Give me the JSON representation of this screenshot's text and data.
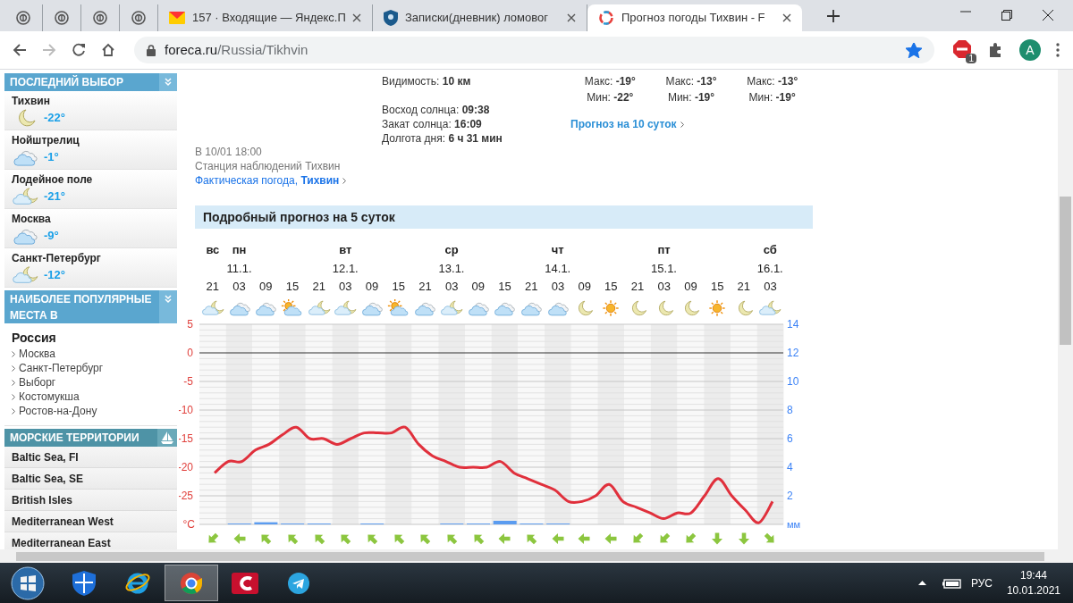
{
  "browser": {
    "tabs": [
      {
        "kind": "pinned",
        "selected": false
      },
      {
        "kind": "pinned",
        "selected": false
      },
      {
        "kind": "pinned",
        "selected": false
      },
      {
        "kind": "pinned",
        "selected": false
      },
      {
        "kind": "mail",
        "title": "157 · Входящие — Яндекс.П",
        "selected": false
      },
      {
        "kind": "diary",
        "title": "Записки(дневник) ломовог",
        "selected": false
      },
      {
        "kind": "weather",
        "title": "Прогноз погоды Тихвин - F",
        "selected": true
      }
    ],
    "url": {
      "host": "foreca.ru",
      "path": "/Russia/Tikhvin"
    },
    "bookmarked": true,
    "extension_badge": "1",
    "avatar": "A"
  },
  "sidebar": {
    "recent": {
      "title": "ПОСЛЕДНИЙ ВЫБОР",
      "places": [
        {
          "name": "Тихвин",
          "temp": "-22°",
          "kind": "moon"
        },
        {
          "name": "Нойштрелиц",
          "temp": "-1°",
          "kind": "cloud"
        },
        {
          "name": "Лодейное поле",
          "temp": "-21°",
          "kind": "cloud-moon"
        },
        {
          "name": "Москва",
          "temp": "-9°",
          "kind": "cloud"
        },
        {
          "name": "Санкт-Петербург",
          "temp": "-12°",
          "kind": "cloud-moon"
        }
      ]
    },
    "popular": {
      "title": "НАИБОЛЕЕ ПОПУЛЯРНЫЕ МЕСТА В",
      "country": "Россия",
      "links": [
        "Москва",
        "Санкт-Петербург",
        "Выборг",
        "Костомукша",
        "Ростов-на-Дону"
      ]
    },
    "marine": {
      "title": "МОРСКИЕ ТЕРРИТОРИИ",
      "items": [
        "Baltic Sea, FI",
        "Baltic Sea, SE",
        "British Isles",
        "Mediterranean West",
        "Mediterranean East"
      ]
    }
  },
  "current": {
    "detail_groups": [
      [
        "Видимость: **10 км**"
      ],
      [
        "Восход солнца: **09:38**",
        "Закат солнца: **16:09**",
        "Долгота дня: **6 ч 31 мин**"
      ]
    ],
    "observed": "В 10/01 18:00",
    "station": "Станция наблюдений Тихвин",
    "actual_link": "Фактическая погода, **Тихвин**"
  },
  "outlook": {
    "days": [
      {
        "max": "Макс: **-19°**",
        "min": "Мин: **-22°**"
      },
      {
        "max": "Макс: **-13°**",
        "min": "Мин: **-19°**"
      },
      {
        "max": "Макс: **-13°**",
        "min": "Мин: **-19°**"
      }
    ],
    "link": "Прогноз на 10 суток"
  },
  "forecast": {
    "title": "Подробный прогноз на 5 суток",
    "columns": [
      {
        "day": "вс",
        "kind": "cloud-moon"
      },
      {
        "day": "пн",
        "date": "11.1.",
        "kind": "cloud"
      },
      {
        "kind": "cloud"
      },
      {
        "kind": "sun-cloud"
      },
      {
        "kind": "cloud-moon"
      },
      {
        "day": "вт",
        "date": "12.1.",
        "kind": "cloud-moon"
      },
      {
        "kind": "cloud"
      },
      {
        "kind": "sun-cloud"
      },
      {
        "kind": "cloud"
      },
      {
        "day": "ср",
        "date": "13.1.",
        "kind": "cloud-moon"
      },
      {
        "kind": "cloud"
      },
      {
        "kind": "cloud"
      },
      {
        "kind": "cloud"
      },
      {
        "day": "чт",
        "date": "14.1.",
        "kind": "cloud"
      },
      {
        "kind": "moon"
      },
      {
        "kind": "sun"
      },
      {
        "kind": "moon"
      },
      {
        "day": "пт",
        "date": "15.1.",
        "kind": "moon"
      },
      {
        "kind": "moon"
      },
      {
        "kind": "sun"
      },
      {
        "kind": "moon"
      },
      {
        "day": "сб",
        "date": "16.1.",
        "kind": "cloud-moon"
      }
    ],
    "temperature_chart": {
      "chart_data": {
        "type": "line",
        "ylabel": "°C",
        "grid": true,
        "ylim": [
          -30,
          5
        ],
        "yticks": [
          5,
          0,
          -5,
          -10,
          -15,
          -20,
          -25
        ],
        "series": [
          {
            "color": "#e0303c",
            "values": [
              -21,
              -19,
              -19,
              -17,
              -16,
              -14.3,
              -13,
              -15,
              -15,
              -16,
              -15,
              -14,
              -14,
              -14,
              -13,
              -16,
              -18,
              -19,
              -20,
              -20,
              -20,
              -19,
              -21,
              -22,
              -23,
              -24,
              -26,
              -26,
              -25,
              -23,
              -26,
              -27,
              -28,
              -29,
              -28,
              -28,
              -25,
              -22,
              -25,
              -27.5,
              -29.7,
              -26
            ]
          }
        ]
      }
    },
    "precipitation_chart": {
      "chart_data": {
        "type": "bar",
        "ylabel": "мм",
        "ylim": [
          0,
          14
        ],
        "yticks": [
          14,
          12,
          10,
          8,
          6,
          4,
          2
        ],
        "categories": [
          "21",
          "03",
          "09",
          "15",
          "21",
          "03",
          "09",
          "15",
          "21",
          "03",
          "09",
          "15",
          "21",
          "03",
          "09",
          "15",
          "21",
          "03",
          "09",
          "15",
          "21",
          "03"
        ],
        "series": [
          {
            "color": "#5b9cf0",
            "values": [
              0,
              0.06,
              0.15,
              0.06,
              0.06,
              0,
              0.06,
              0,
              0,
              0.06,
              0.06,
              0.25,
              0.06,
              0.06,
              0,
              0,
              0,
              0,
              0,
              0,
              0,
              0
            ]
          }
        ]
      }
    },
    "wind_arrows": [
      {
        "kind": "down-left"
      },
      {
        "kind": "left"
      },
      {
        "kind": "up-left"
      },
      {
        "kind": "up-left"
      },
      {
        "kind": "up-left"
      },
      {
        "kind": "up-left"
      },
      {
        "kind": "up-left"
      },
      {
        "kind": "up-left"
      },
      {
        "kind": "up-left"
      },
      {
        "kind": "up-left"
      },
      {
        "kind": "up-left"
      },
      {
        "kind": "left"
      },
      {
        "kind": "up-left"
      },
      {
        "kind": "left"
      },
      {
        "kind": "left"
      },
      {
        "kind": "left"
      },
      {
        "kind": "down-left"
      },
      {
        "kind": "down-left"
      },
      {
        "kind": "down-left"
      },
      {
        "kind": "down"
      },
      {
        "kind": "down"
      },
      {
        "kind": "down-right"
      }
    ]
  },
  "taskbar": {
    "apps": [
      {
        "kind": "start",
        "selected": false
      },
      {
        "kind": "shield",
        "selected": false
      },
      {
        "kind": "ie",
        "selected": false
      },
      {
        "kind": "chrome",
        "selected": true
      },
      {
        "kind": "red",
        "selected": false
      },
      {
        "kind": "telegram",
        "selected": false
      }
    ],
    "language": "РУС",
    "time": "19:44",
    "date": "10.01.2021"
  }
}
